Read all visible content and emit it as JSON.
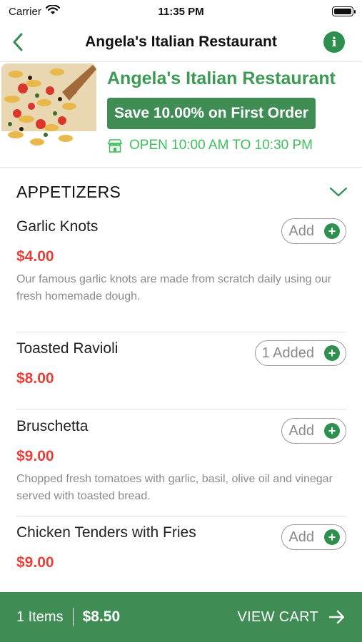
{
  "status_bar": {
    "carrier": "Carrier",
    "time": "11:35 PM"
  },
  "nav": {
    "title": "Angela's Italian Restaurant",
    "back_icon": "chevron-left-icon",
    "info_icon": "info-icon"
  },
  "restaurant": {
    "name": "Angela's Italian Restaurant",
    "promo": "Save 10.00% on First Order",
    "hours": "OPEN 10:00 AM TO 10:30 PM"
  },
  "menu": {
    "section_title": "APPETIZERS",
    "items": [
      {
        "name": "Garlic Knots",
        "price": "$4.00",
        "description": "Our famous garlic knots are made from scratch daily using our fresh homemade dough.",
        "button": "Add"
      },
      {
        "name": "Toasted Ravioli",
        "price": "$8.00",
        "description": "",
        "button": "1 Added"
      },
      {
        "name": "Bruschetta",
        "price": "$9.00",
        "description": "Chopped fresh tomatoes with garlic, basil, olive oil and vinegar served with toasted bread.",
        "button": "Add"
      },
      {
        "name": "Chicken Tenders with Fries",
        "price": "$9.00",
        "description": "",
        "button": "Add"
      }
    ]
  },
  "cart": {
    "count": "1 Items",
    "total": "$8.50",
    "action": "VIEW CART"
  },
  "colors": {
    "brand_green": "#3f8d54",
    "price_red": "#e4413a",
    "hours_green": "#3fbf5c"
  }
}
